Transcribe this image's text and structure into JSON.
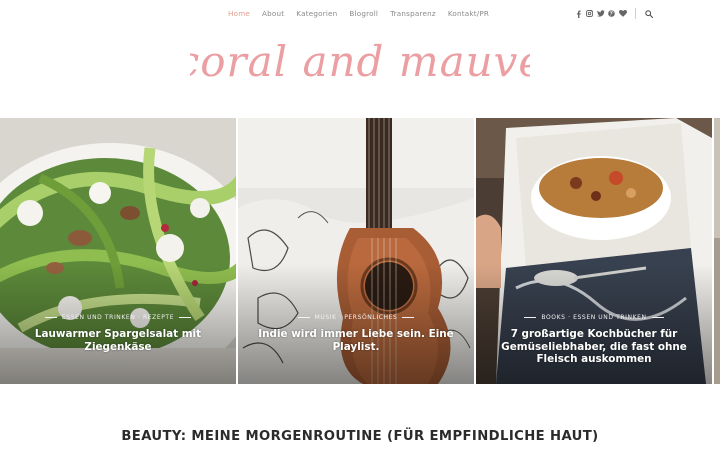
{
  "nav": {
    "items": [
      "Home",
      "About",
      "Kategorien",
      "Blogroll",
      "Transparenz",
      "Kontakt/PR"
    ],
    "active_index": 0,
    "social_icons": [
      "facebook-icon",
      "instagram-icon",
      "twitter-icon",
      "pinterest-icon",
      "bloglovin-heart-icon"
    ],
    "search_icon": "search-icon"
  },
  "logo": {
    "text": "coral and mauve",
    "color": "#e88e92"
  },
  "slider": {
    "slides": [
      {
        "categories": [
          "ESSEN UND TRINKEN",
          "REZEPTE"
        ],
        "title": "Lauwarmer Spargelsalat mit Ziegenkäse"
      },
      {
        "categories": [
          "MUSIK",
          "PERSÖNLICHES"
        ],
        "title": "Indie wird immer Liebe sein. Eine Playlist."
      },
      {
        "categories": [
          "BOOKS",
          "ESSEN UND TRINKEN"
        ],
        "title": "7 großartige Kochbücher für Gemüseliebhaber, die fast ohne Fleisch auskommen"
      }
    ]
  },
  "post": {
    "title": "BEAUTY: MEINE MORGENROUTINE (FÜR EMPFINDLICHE HAUT)"
  },
  "colors": {
    "accent": "#e3a090",
    "nav_text": "#8a8a8a"
  }
}
